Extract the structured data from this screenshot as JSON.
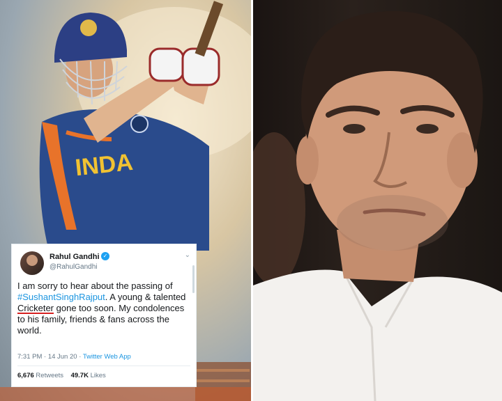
{
  "tweet": {
    "name": "Rahul Gandhi",
    "handle": "@RahulGandhi",
    "text_1": "I am sorry to hear about the passing of ",
    "hashtag": "#SushantSinghRajput",
    "text_2": ". A young & talented ",
    "underlined_word": "Cricketer",
    "text_3": " gone too soon. My condolences to his family, friends & fans across the world.",
    "time": "7:31 PM · 14 Jun 20 · ",
    "source": "Twitter Web App",
    "retweets_count": "6,676",
    "retweets_label": "Retweets",
    "likes_count": "49.7K",
    "likes_label": "Likes"
  },
  "poster": {
    "jersey_text": "INDA"
  },
  "colors": {
    "jersey_blue": "#2a4b8c",
    "jersey_orange": "#e8732a",
    "twitter_blue": "#1b95e0",
    "underline_red": "#d62020"
  }
}
